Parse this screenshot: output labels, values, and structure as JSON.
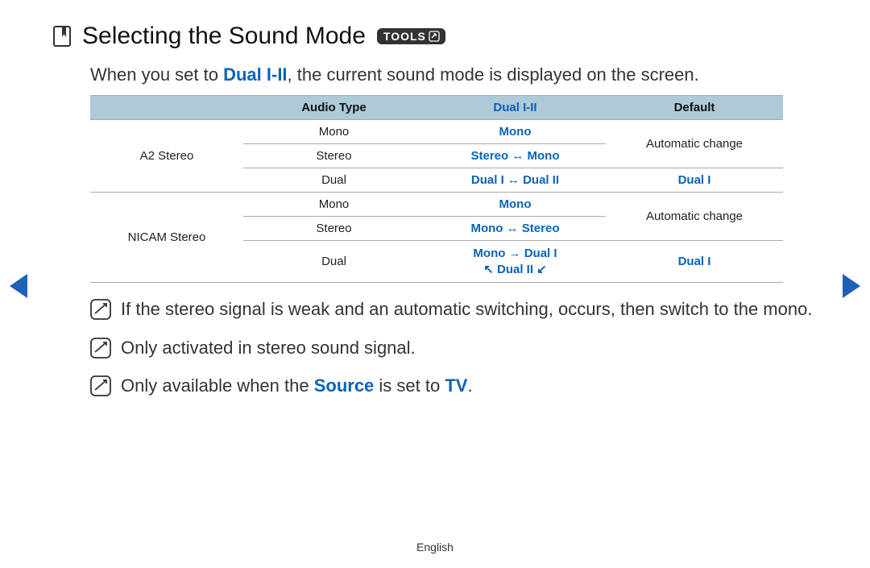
{
  "heading": {
    "title": "Selecting the Sound Mode",
    "tools_label": "TOOLS"
  },
  "intro": {
    "prefix": "When you set to ",
    "bold": "Dual I-II",
    "suffix": ", the current sound mode is displayed on the screen."
  },
  "table": {
    "headers": {
      "col1": "",
      "col2": "Audio Type",
      "col3": "Dual I-II",
      "col4": "Default"
    },
    "rows": [
      {
        "group": "A2 Stereo",
        "type": "Mono",
        "dual": "Mono",
        "def": "Automatic change"
      },
      {
        "group": "",
        "type": "Stereo",
        "dual": "Stereo ↔ Mono",
        "def": ""
      },
      {
        "group": "",
        "type": "Dual",
        "dual": "Dual I ↔ Dual II",
        "def": "Dual I"
      },
      {
        "group": "NICAM Stereo",
        "type": "Mono",
        "dual": "Mono",
        "def": "Automatic change"
      },
      {
        "group": "",
        "type": "Stereo",
        "dual": "Mono ↔ Stereo",
        "def": ""
      },
      {
        "group": "",
        "type": "Dual",
        "dual_line1": "Mono → Dual I",
        "dual_line2": "↖ Dual II ↙",
        "def": "Dual I"
      }
    ]
  },
  "notes": [
    {
      "text": "If the stereo signal is weak and an automatic switching, occurs, then switch to the mono."
    },
    {
      "text": "Only activated in stereo sound signal."
    },
    {
      "prefix": "Only available when the ",
      "bold1": "Source",
      "mid": " is set to ",
      "bold2": "TV",
      "suffix": "."
    }
  ],
  "footer": {
    "language": "English"
  }
}
